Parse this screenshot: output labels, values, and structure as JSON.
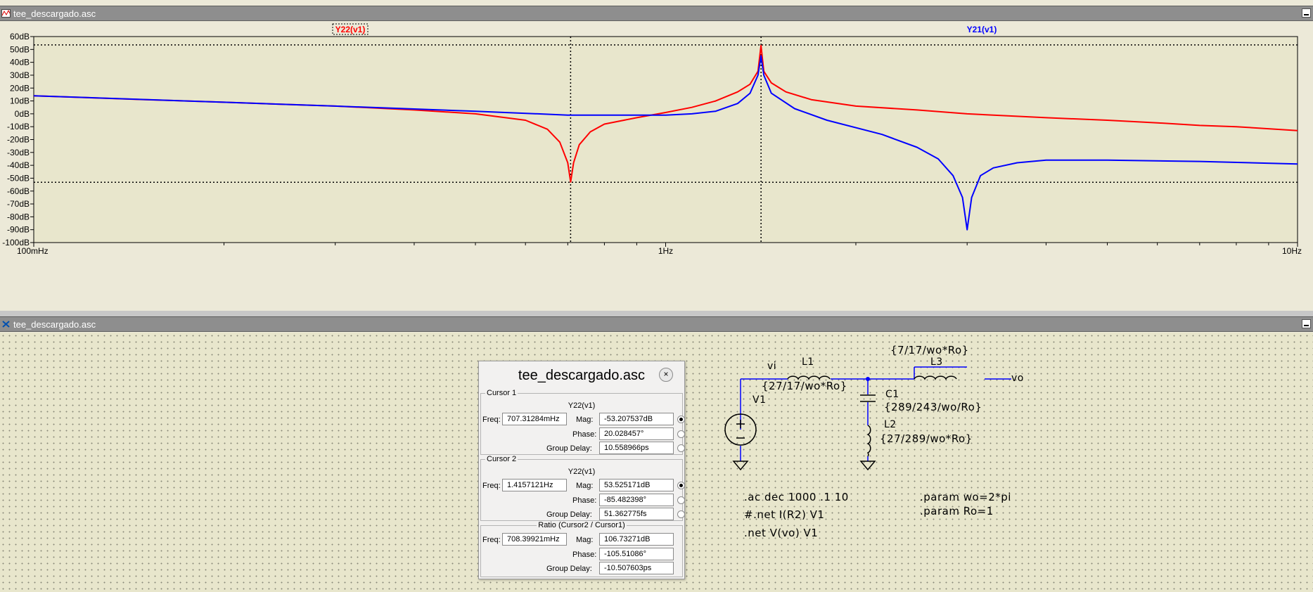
{
  "plot_window": {
    "title": "tee_descargado.asc"
  },
  "schematic_window": {
    "title": "tee_descargado.asc"
  },
  "chart_data": {
    "type": "line",
    "x_scale": "log",
    "xlim": [
      0.1,
      10
    ],
    "ylim": [
      -100,
      60
    ],
    "y_ticks": [
      "60dB",
      "50dB",
      "40dB",
      "30dB",
      "20dB",
      "10dB",
      "0dB",
      "-10dB",
      "-20dB",
      "-30dB",
      "-40dB",
      "-50dB",
      "-60dB",
      "-70dB",
      "-80dB",
      "-90dB",
      "-100dB"
    ],
    "x_tick_labels": [
      "100mHz",
      "1Hz",
      "10Hz"
    ],
    "series": [
      {
        "name": "Y22(v1)",
        "color": "#ff0000",
        "x": [
          0.1,
          0.15,
          0.2,
          0.3,
          0.4,
          0.5,
          0.6,
          0.65,
          0.68,
          0.7,
          0.7073,
          0.715,
          0.73,
          0.76,
          0.8,
          0.9,
          1.0,
          1.1,
          1.2,
          1.3,
          1.36,
          1.4,
          1.4157,
          1.43,
          1.47,
          1.55,
          1.7,
          2.0,
          2.5,
          3,
          4,
          5,
          6,
          7,
          8,
          10
        ],
        "y": [
          14,
          11,
          9,
          6,
          3,
          0,
          -5,
          -12,
          -22,
          -38,
          -53,
          -38,
          -24,
          -14,
          -8,
          -3,
          1,
          5,
          10,
          17,
          23,
          33,
          53,
          33,
          24,
          17,
          11,
          6,
          3,
          0,
          -3,
          -5,
          -7,
          -9,
          -10,
          -13
        ]
      },
      {
        "name": "Y21(v1)",
        "color": "#0000ff",
        "x": [
          0.1,
          0.2,
          0.3,
          0.5,
          0.7,
          0.85,
          1.0,
          1.1,
          1.2,
          1.3,
          1.36,
          1.4,
          1.4157,
          1.43,
          1.47,
          1.6,
          1.8,
          2.2,
          2.5,
          2.7,
          2.85,
          2.95,
          3.0,
          3.05,
          3.15,
          3.3,
          3.6,
          4,
          5,
          7,
          10
        ],
        "y": [
          14,
          9,
          6,
          2,
          -1,
          -1,
          -1,
          0,
          2,
          8,
          16,
          30,
          45,
          30,
          16,
          4,
          -5,
          -16,
          -26,
          -35,
          -48,
          -65,
          -90,
          -65,
          -48,
          -42,
          -38,
          -36,
          -36,
          -37,
          -39
        ]
      }
    ],
    "cursor_x": [
      0.70731284,
      1.4157121
    ],
    "cursor_y": [
      -53.207537,
      53.525171
    ]
  },
  "schematic": {
    "labels": {
      "vi": "vi",
      "vo": "vo",
      "L1": "L1",
      "L1_value": "{27/17/wo*Ro}",
      "L3": "L3",
      "L3_value": "{7/17/wo*Ro}",
      "C1": "C1",
      "C1_value": "{289/243/wo/Ro}",
      "L2": "L2",
      "L2_value": "{27/289/wo*Ro}",
      "V1": "V1"
    },
    "directives": {
      "ac": ".ac dec 1000 .1 10",
      "net1": "#.net I(R2) V1",
      "net2": ".net V(vo) V1",
      "param_wo": ".param wo=2*pi",
      "param_ro": ".param Ro=1"
    }
  },
  "cursor_dialog": {
    "title": "tee_descargado.asc",
    "close_glyph": "×",
    "cursor1": {
      "label": "Cursor 1",
      "trace": "Y22(v1)",
      "freq_label": "Freq:",
      "freq": "707.31284mHz",
      "mag_label": "Mag:",
      "mag": "-53.207537dB",
      "phase_label": "Phase:",
      "phase": "20.028457°",
      "gd_label": "Group Delay:",
      "gd": "10.558966ps"
    },
    "cursor2": {
      "label": "Cursor 2",
      "trace": "Y22(v1)",
      "freq_label": "Freq:",
      "freq": "1.4157121Hz",
      "mag_label": "Mag:",
      "mag": "53.525171dB",
      "phase_label": "Phase:",
      "phase": "-85.482398°",
      "gd_label": "Group Delay:",
      "gd": "51.362775fs"
    },
    "ratio": {
      "label": "Ratio (Cursor2 / Cursor1)",
      "freq_label": "Freq:",
      "freq": "708.39921mHz",
      "mag_label": "Mag:",
      "mag": "106.73271dB",
      "phase_label": "Phase:",
      "phase": "-105.51086°",
      "gd_label": "Group Delay:",
      "gd": "-10.507603ps"
    }
  }
}
